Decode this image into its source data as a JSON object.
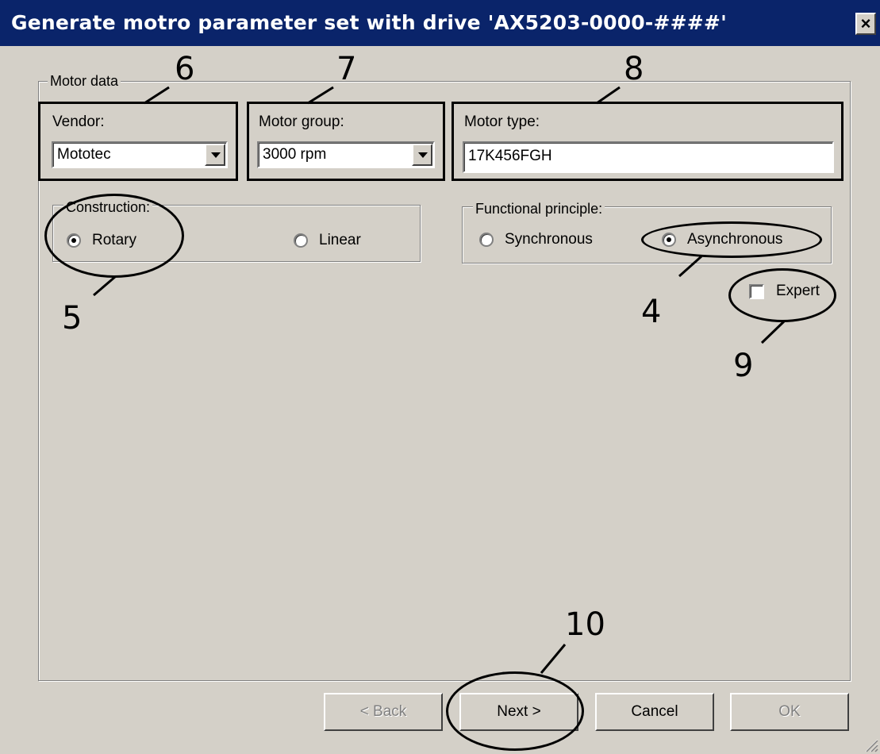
{
  "window": {
    "title": "Generate motro parameter set with drive 'AX5203-0000-####'",
    "close_label": "×"
  },
  "motor_data": {
    "legend": "Motor data",
    "vendor": {
      "label": "Vendor:",
      "value": "Mototec"
    },
    "motor_group": {
      "label": "Motor group:",
      "value": "3000 rpm"
    },
    "motor_type": {
      "label": "Motor type:",
      "value": "17K456FGH"
    },
    "construction": {
      "legend": "Construction:",
      "options": [
        "Rotary",
        "Linear"
      ],
      "selected": "Rotary"
    },
    "functional_principle": {
      "legend": "Functional principle:",
      "options": [
        "Synchronous",
        "Asynchronous"
      ],
      "selected": "Asynchronous"
    },
    "expert": {
      "label": "Expert",
      "checked": false
    }
  },
  "buttons": {
    "back": "< Back",
    "next": "Next >",
    "cancel": "Cancel",
    "ok": "OK"
  },
  "callouts": {
    "c4": "4",
    "c5": "5",
    "c6": "6",
    "c7": "7",
    "c8": "8",
    "c9": "9",
    "c10": "10"
  }
}
